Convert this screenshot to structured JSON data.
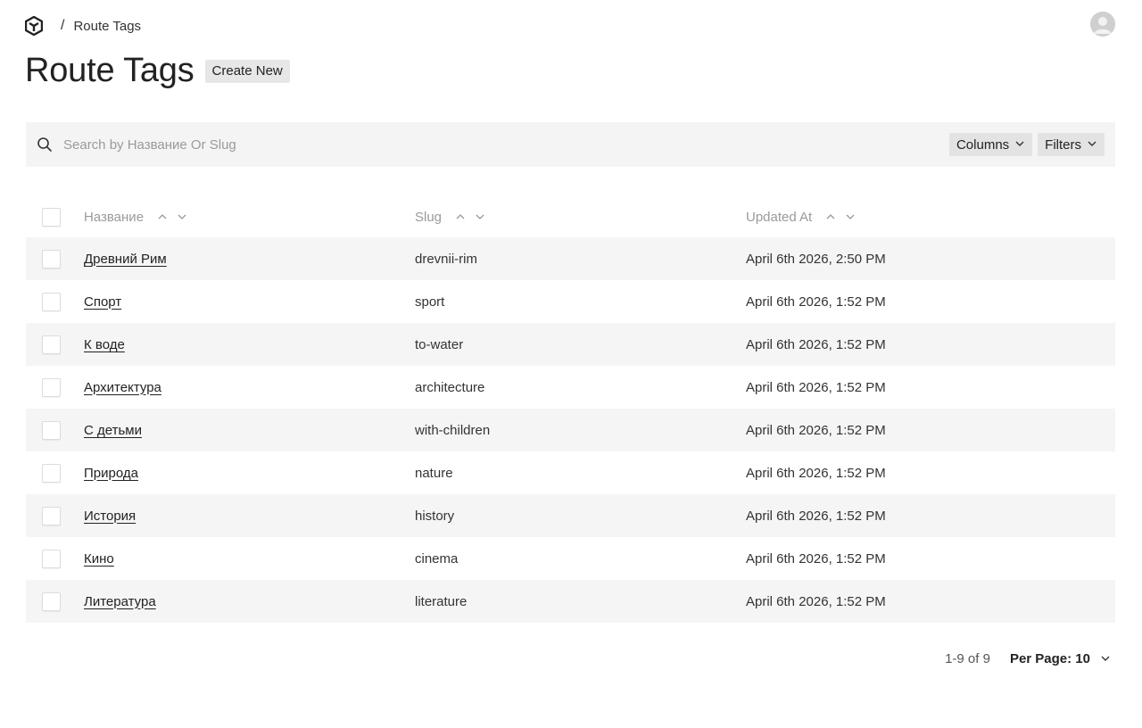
{
  "breadcrumb": {
    "separator": "/",
    "current": "Route Tags"
  },
  "header": {
    "title": "Route Tags",
    "create_label": "Create New"
  },
  "search": {
    "placeholder": "Search by Название Or Slug",
    "value": ""
  },
  "toolbar": {
    "columns_label": "Columns",
    "filters_label": "Filters"
  },
  "table": {
    "columns": [
      "Название",
      "Slug",
      "Updated At"
    ],
    "rows": [
      {
        "name": "Древний Рим",
        "slug": "drevnii-rim",
        "updated": "April 6th 2026, 2:50 PM"
      },
      {
        "name": "Спорт",
        "slug": "sport",
        "updated": "April 6th 2026, 1:52 PM"
      },
      {
        "name": "К воде",
        "slug": "to-water",
        "updated": "April 6th 2026, 1:52 PM"
      },
      {
        "name": "Архитектура",
        "slug": "architecture",
        "updated": "April 6th 2026, 1:52 PM"
      },
      {
        "name": "С детьми",
        "slug": "with-children",
        "updated": "April 6th 2026, 1:52 PM"
      },
      {
        "name": "Природа",
        "slug": "nature",
        "updated": "April 6th 2026, 1:52 PM"
      },
      {
        "name": "История",
        "slug": "history",
        "updated": "April 6th 2026, 1:52 PM"
      },
      {
        "name": "Кино",
        "slug": "cinema",
        "updated": "April 6th 2026, 1:52 PM"
      },
      {
        "name": "Литература",
        "slug": "literature",
        "updated": "April 6th 2026, 1:52 PM"
      }
    ]
  },
  "pagination": {
    "range": "1-9 of 9",
    "per_page": "Per Page: 10"
  },
  "colors": {
    "row_alt": "#f5f5f5",
    "search_bg": "#f4f4f4",
    "pill_bg": "#e3e3e3",
    "muted_text": "#9a9a9a"
  },
  "icons": {
    "logo": "app-logo-icon",
    "search": "search-icon",
    "chevron": "chevron-down-icon",
    "sort_up": "sort-asc-icon",
    "sort_down": "sort-desc-icon",
    "avatar": "user-avatar-icon"
  }
}
